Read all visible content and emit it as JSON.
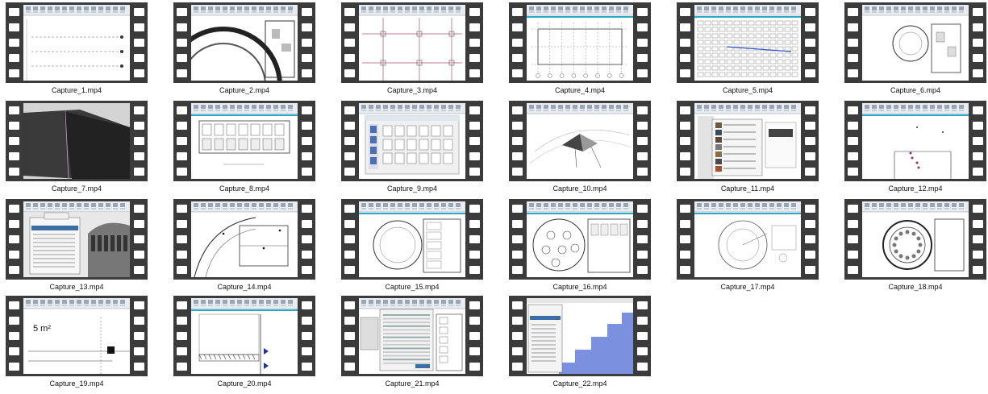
{
  "files": [
    {
      "name": "Capture_1.mp4",
      "scene": "plan-lines"
    },
    {
      "name": "Capture_2.mp4",
      "scene": "curved-walls"
    },
    {
      "name": "Capture_3.mp4",
      "scene": "grid-plan"
    },
    {
      "name": "Capture_4.mp4",
      "scene": "column-grid"
    },
    {
      "name": "Capture_5.mp4",
      "scene": "seating-plan"
    },
    {
      "name": "Capture_6.mp4",
      "scene": "round-plan"
    },
    {
      "name": "Capture_7.mp4",
      "scene": "3d-dark"
    },
    {
      "name": "Capture_8.mp4",
      "scene": "floor-detail"
    },
    {
      "name": "Capture_9.mp4",
      "scene": "dialog-icons"
    },
    {
      "name": "Capture_10.mp4",
      "scene": "3d-pyramid"
    },
    {
      "name": "Capture_11.mp4",
      "scene": "material-dialog"
    },
    {
      "name": "Capture_12.mp4",
      "scene": "sparse-plan"
    },
    {
      "name": "Capture_13.mp4",
      "scene": "properties-3d"
    },
    {
      "name": "Capture_14.mp4",
      "scene": "curved-plan"
    },
    {
      "name": "Capture_15.mp4",
      "scene": "round-room"
    },
    {
      "name": "Capture_16.mp4",
      "scene": "round-tables"
    },
    {
      "name": "Capture_17.mp4",
      "scene": "circle-plan"
    },
    {
      "name": "Capture_18.mp4",
      "scene": "round-hall"
    },
    {
      "name": "Capture_19.mp4",
      "scene": "area-tag"
    },
    {
      "name": "Capture_20.mp4",
      "scene": "section-detail"
    },
    {
      "name": "Capture_21.mp4",
      "scene": "schedule-dialog"
    },
    {
      "name": "Capture_22.mp4",
      "scene": "stairs"
    }
  ],
  "overlay_text": {
    "area_tag": "5 m²"
  },
  "colors": {
    "background": "#ffffff",
    "film": "#3b3b3b",
    "caption": "#111111",
    "accent": "#2aa7c9"
  }
}
